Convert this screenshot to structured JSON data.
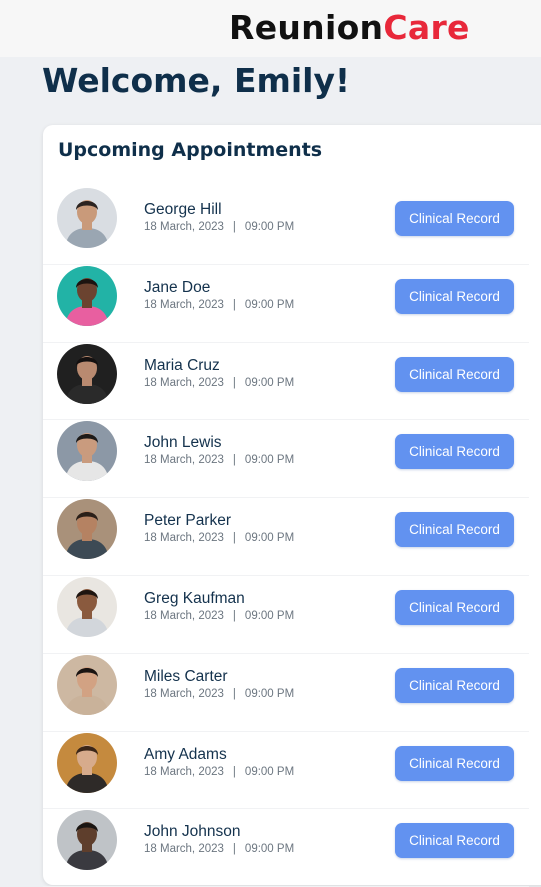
{
  "app": {
    "logo_part1": "Reunion",
    "logo_part2": "Care"
  },
  "header": {
    "welcome": "Welcome, Emily!"
  },
  "appointments": {
    "title": "Upcoming Appointments",
    "button_label": "Clinical Record",
    "separator": "|",
    "items": [
      {
        "name": "George Hill",
        "date": "18 March, 2023",
        "time": "09:00 PM",
        "avatar_bg": "#d9dde2",
        "skin": "#c99a7a",
        "hair": "#2b2320",
        "shirt": "#9aa6b2"
      },
      {
        "name": "Jane Doe",
        "date": "18 March, 2023",
        "time": "09:00 PM",
        "avatar_bg": "#22b3a6",
        "skin": "#6b4330",
        "hair": "#1c1410",
        "shirt": "#e85fa0"
      },
      {
        "name": "Maria Cruz",
        "date": "18 March, 2023",
        "time": "09:00 PM",
        "avatar_bg": "#202020",
        "skin": "#b98a70",
        "hair": "#141010",
        "shirt": "#2a2a2a"
      },
      {
        "name": "John Lewis",
        "date": "18 March, 2023",
        "time": "09:00 PM",
        "avatar_bg": "#8c98a6",
        "skin": "#c99b7e",
        "hair": "#1d1a18",
        "shirt": "#e6e6e6"
      },
      {
        "name": "Peter Parker",
        "date": "18 March, 2023",
        "time": "09:00 PM",
        "avatar_bg": "#a9917a",
        "skin": "#b58262",
        "hair": "#2a1f18",
        "shirt": "#3d4a55"
      },
      {
        "name": "Greg Kaufman",
        "date": "18 March, 2023",
        "time": "09:00 PM",
        "avatar_bg": "#e9e6e1",
        "skin": "#8a5a3e",
        "hair": "#1e1510",
        "shirt": "#d2d6db"
      },
      {
        "name": "Miles Carter",
        "date": "18 March, 2023",
        "time": "09:00 PM",
        "avatar_bg": "#cdb8a2",
        "skin": "#d2a283",
        "hair": "#1a1412",
        "shirt": "#c9b29a"
      },
      {
        "name": "Amy Adams",
        "date": "18 March, 2023",
        "time": "09:00 PM",
        "avatar_bg": "#c58a3e",
        "skin": "#d7ab8c",
        "hair": "#3b2618",
        "shirt": "#2e2a28"
      },
      {
        "name": "John Johnson",
        "date": "18 March, 2023",
        "time": "09:00 PM",
        "avatar_bg": "#bfc3c7",
        "skin": "#5e3e2c",
        "hair": "#1a1512",
        "shirt": "#3a3a40"
      }
    ]
  }
}
